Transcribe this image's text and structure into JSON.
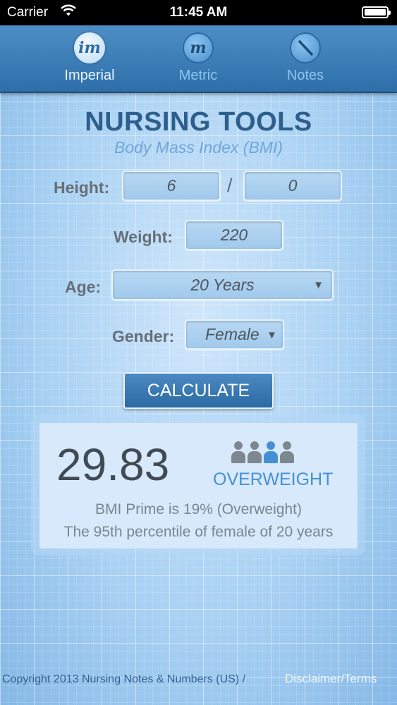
{
  "status_bar": {
    "carrier": "Carrier",
    "time": "11:45 AM"
  },
  "tabs": [
    {
      "label": "Imperial",
      "icon": "im-icon",
      "glyph": "im",
      "active": true
    },
    {
      "label": "Metric",
      "icon": "m-icon",
      "glyph": "m",
      "active": false
    },
    {
      "label": "Notes",
      "icon": "pencil-icon",
      "glyph": "",
      "active": false
    }
  ],
  "header": {
    "title": "NURSING TOOLS",
    "subtitle": "Body Mass Index (BMI)"
  },
  "form": {
    "height_label": "Height:",
    "height_feet": "6",
    "height_separator": "/",
    "height_inches": "0",
    "weight_label": "Weight:",
    "weight_value": "220",
    "age_label": "Age:",
    "age_value": "20 Years",
    "gender_label": "Gender:",
    "gender_value": "Female",
    "calculate_label": "CALCULATE"
  },
  "result": {
    "bmi": "29.83",
    "category": "OVERWEIGHT",
    "category_index": 3,
    "category_color": "#4590d4",
    "prime_text": "BMI Prime is 19% (Overweight)",
    "percentile_text": "The 95th percentile of female of 20 years"
  },
  "footer": {
    "copyright": "Copyright 2013 Nursing Notes & Numbers (US) /",
    "link": "Disclaimer/Terms"
  }
}
